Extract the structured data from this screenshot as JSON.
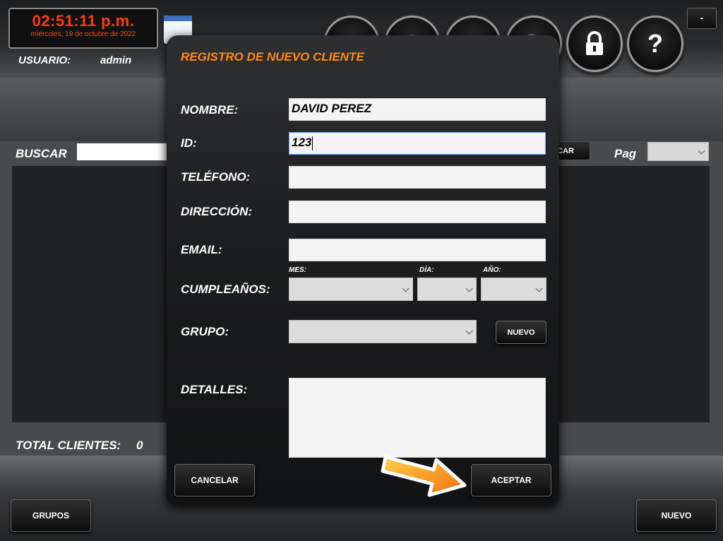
{
  "clock": {
    "time": "02:51:11 p.m.",
    "date": "miércoles, 19 de octubre de 2022"
  },
  "user": {
    "label": "USUARIO:",
    "name": "admin"
  },
  "topbar": {
    "buttons": [
      {
        "icon": "home-icon"
      },
      {
        "icon": "users-icon"
      },
      {
        "icon": "notes-icon"
      },
      {
        "icon": "search-icon"
      },
      {
        "icon": "lock-icon"
      },
      {
        "icon": "help-icon",
        "glyph": "?"
      }
    ],
    "minimize_label": "-"
  },
  "search": {
    "label": "BUSCAR",
    "button_label": "CAR"
  },
  "pagination": {
    "label": "Pag"
  },
  "footer": {
    "total_label": "TOTAL CLIENTES:",
    "total_value": "0",
    "groups_button": "GRUPOS",
    "new_button": "NUEVO"
  },
  "dialog": {
    "title": "REGISTRO DE NUEVO CLIENTE",
    "fields": {
      "nombre": {
        "label": "NOMBRE:",
        "value": "DAVID PEREZ"
      },
      "id": {
        "label": "ID:",
        "value": "123"
      },
      "telefono": {
        "label": "TELÉFONO:",
        "value": ""
      },
      "direccion": {
        "label": "DIRECCIÓN:",
        "value": ""
      },
      "email": {
        "label": "EMAIL:",
        "value": ""
      },
      "cumpleanos": {
        "label": "CUMPLEAÑOS:",
        "mes_label": "MES:",
        "dia_label": "DÍA:",
        "anio_label": "AÑO:"
      },
      "grupo": {
        "label": "GRUPO:",
        "new_button": "NUEVO"
      },
      "detalles": {
        "label": "DETALLES:",
        "value": ""
      }
    },
    "cancel_button": "CANCELAR",
    "accept_button": "ACEPTAR"
  },
  "colors": {
    "accent": "#ff8a1c",
    "clock_red": "#ff3a10",
    "arrow_orange": "#f7a21b"
  }
}
